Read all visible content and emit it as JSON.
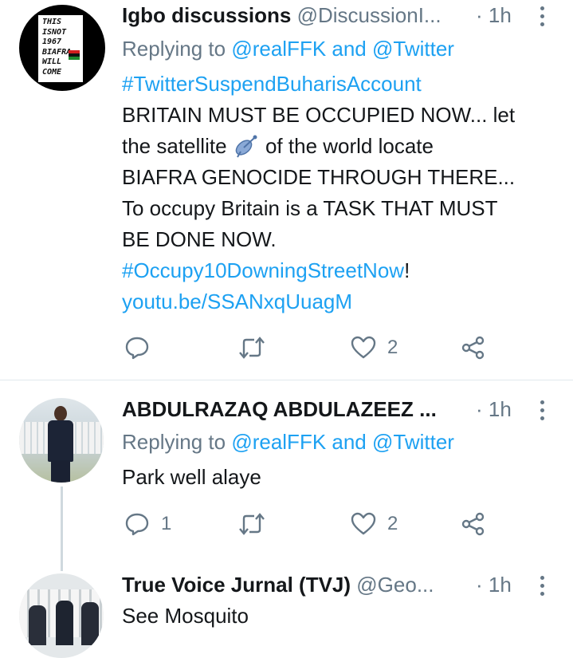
{
  "tweets": [
    {
      "name": "Igbo discussions",
      "handle": "@DiscussionI...",
      "time": "· 1h",
      "reply_prefix": "Replying to ",
      "reply_to": "@realFFK and @Twitter",
      "avatar_text": [
        "THIS",
        "ISNOT",
        "1967",
        "BIAFRA",
        "WILL",
        "COME"
      ],
      "lines": [
        "#TwitterSuspendBuharisAccount",
        "BRITAIN MUST BE OCCUPIED NOW... let",
        "the satellite ",
        " of the world locate",
        "BIAFRA GENOCIDE THROUGH THERE...",
        "To occupy Britain is a TASK THAT MUST",
        "BE DONE NOW.",
        "#Occupy10DowningStreetNow",
        "!",
        "youtu.be/SSANxqUuagM"
      ],
      "replies": "",
      "retweets": "",
      "likes": "2"
    },
    {
      "name": "ABDULRAZAQ ABDULAZEEZ ...",
      "handle": "",
      "time": "· 1h",
      "reply_prefix": "Replying to ",
      "reply_to": "@realFFK and @Twitter",
      "text": "Park well alaye",
      "replies": "1",
      "retweets": "",
      "likes": "2"
    },
    {
      "name": "True Voice Jurnal (TVJ)",
      "handle": "@Geo...",
      "time": "· 1h",
      "text": "See Mosquito"
    }
  ],
  "colors": {
    "link": "#1da1f2",
    "meta": "#657786",
    "text": "#14171a",
    "divider": "#e1e8ed"
  }
}
